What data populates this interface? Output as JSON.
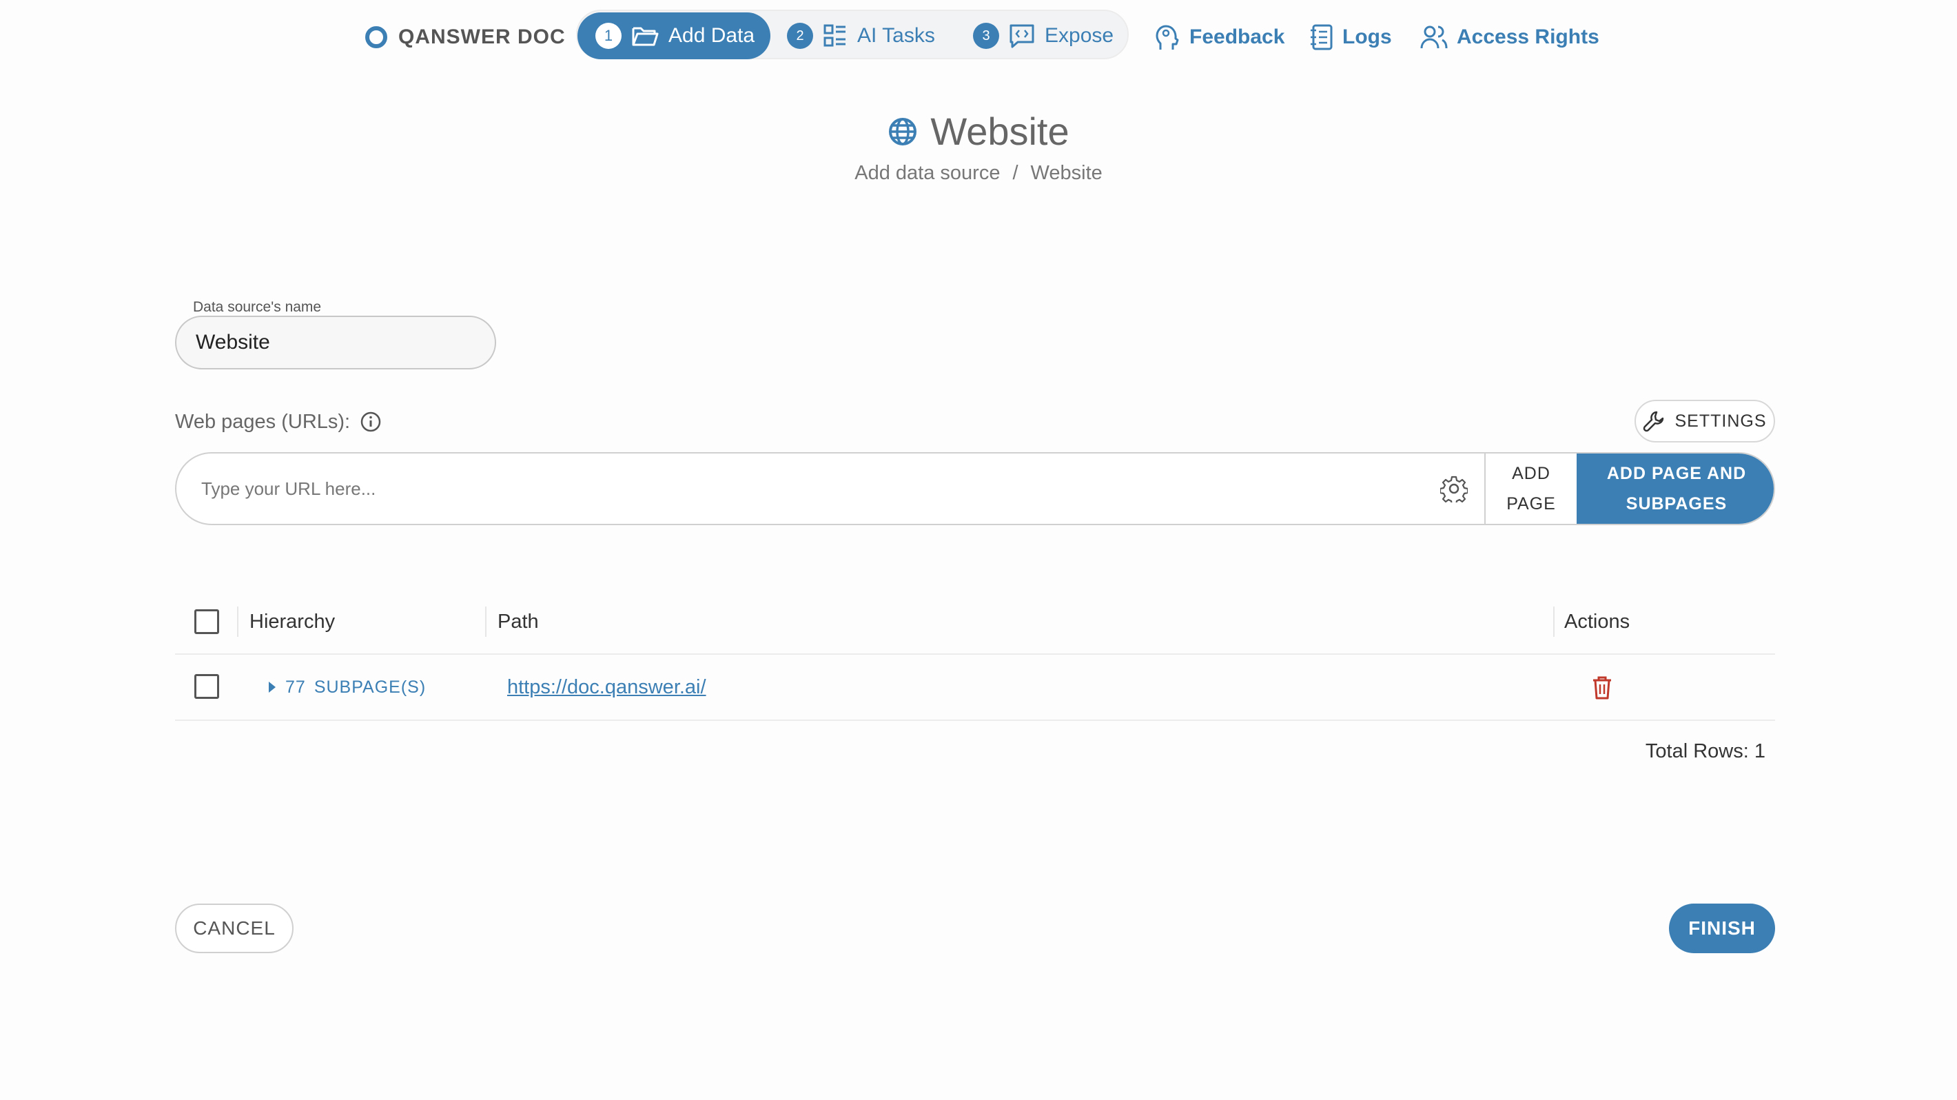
{
  "nav": {
    "brand": "QANSWER DOC",
    "steps": [
      {
        "number": "1",
        "label": "Add Data",
        "icon": "folder-open-icon",
        "active": true
      },
      {
        "number": "2",
        "label": "AI Tasks",
        "icon": "list-icon",
        "active": false
      },
      {
        "number": "3",
        "label": "Expose",
        "icon": "code-bubble-icon",
        "active": false
      }
    ],
    "links": [
      {
        "label": "Feedback",
        "icon": "head-feedback-icon"
      },
      {
        "label": "Logs",
        "icon": "notebook-icon"
      },
      {
        "label": "Access Rights",
        "icon": "users-icon"
      }
    ]
  },
  "header": {
    "title": "Website",
    "title_icon": "globe-icon",
    "breadcrumb": [
      "Add data source",
      "/",
      "Website"
    ]
  },
  "form": {
    "name_label": "Data source's name",
    "name_value": "Website",
    "web_label": "Web pages (URLs):",
    "web_info_icon": "info-icon",
    "settings_label": "SETTINGS",
    "url_placeholder": "Type your URL here...",
    "add_page_label": "ADD\nPAGE",
    "add_subpages_label": "ADD PAGE AND\nSUBPAGES"
  },
  "table": {
    "columns": [
      "Hierarchy",
      "Path",
      "Actions"
    ],
    "rows": [
      {
        "subpage_count": "77",
        "subpage_label": "SUBPAGE(S)",
        "path": "https://doc.qanswer.ai/"
      }
    ],
    "total_rows": "Total Rows: 1"
  },
  "footer": {
    "cancel_label": "CANCEL",
    "finish_label": "FINISH"
  },
  "colors": {
    "accent": "#3b7fb4",
    "delete": "#c0392b",
    "background": "#fdfdfd"
  }
}
